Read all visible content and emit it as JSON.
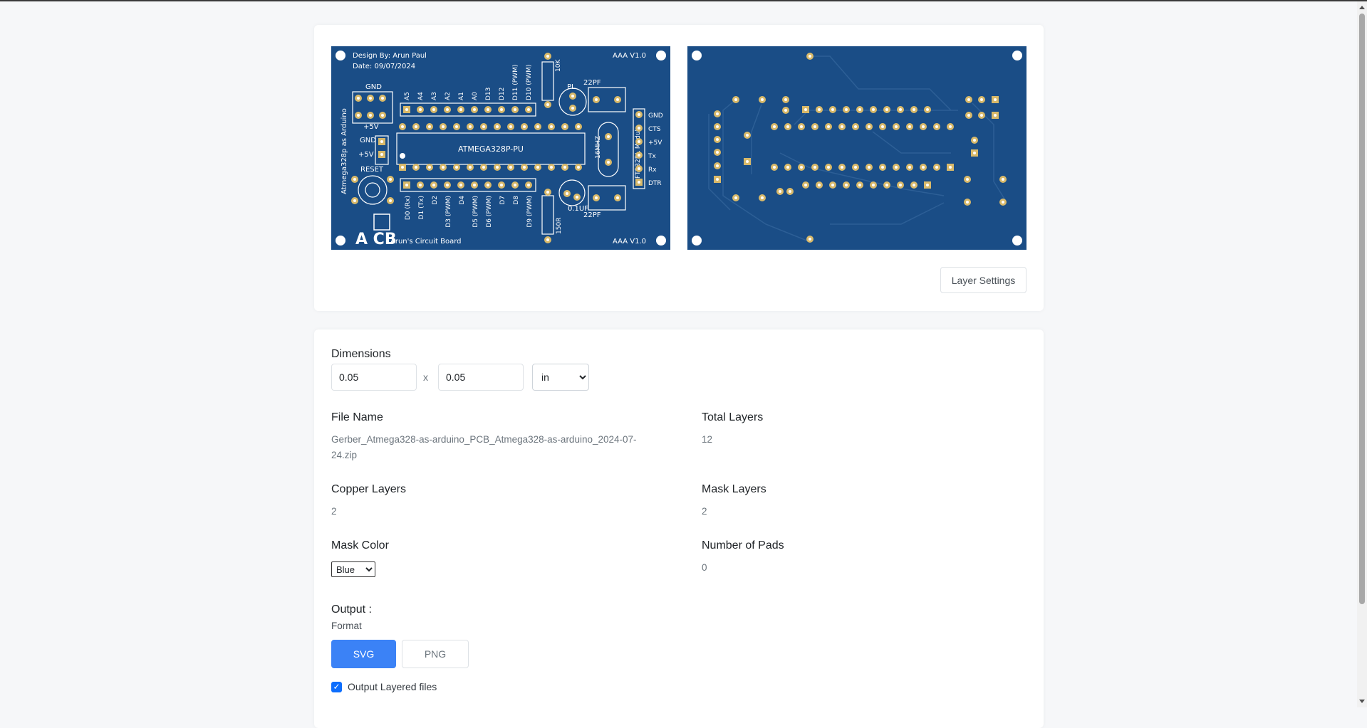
{
  "preview": {
    "front": {
      "design_by": "Design By: Arun Paul",
      "date": "Date: 09/07/2024",
      "version": "AAA V1.0",
      "chip_label": "ATMEGA328P-PU",
      "side_label": "Atmega328p as Arduino",
      "gnd_label": "GND",
      "plus5v_label": "+5V",
      "gnd_label2": "GND",
      "plus5v_label2": "+5V",
      "reset_label": "RESET",
      "top_pins": [
        "A5",
        "A4",
        "A3",
        "A2",
        "A1",
        "A0",
        "D13",
        "D12",
        "D11 (PWM)",
        "D10 (PWM)"
      ],
      "bottom_pins": [
        "D0 (Rx)",
        "D1 (Tx)",
        "D2",
        "D3 (PWM)",
        "D4",
        "D5 (PWM)",
        "D6 (PWM)",
        "D7",
        "D8",
        "D9 (PWM)"
      ],
      "resistor_top": "10K",
      "resistor_bottom": "150R",
      "led_label": "PL",
      "cap_top": "22PF",
      "cap_bottom": "22PF",
      "crystal": "16MHZ",
      "elec_cap": "0.1UF",
      "module_label": "FT232RL Module",
      "module_pins": [
        "GND",
        "CTS",
        "+5V",
        "Tx",
        "Rx",
        "DTR"
      ],
      "brand": "Arun's Circuit Board",
      "logo_text": "A CB"
    },
    "layer_settings_label": "Layer Settings"
  },
  "form": {
    "dimensions_label": "Dimensions",
    "width_value": "0.05",
    "height_value": "0.05",
    "x_sep": "x",
    "unit_selected": "in",
    "file_name_label": "File Name",
    "file_name_value": "Gerber_Atmega328-as-arduino_PCB_Atmega328-as-arduino_2024-07-24.zip",
    "total_layers_label": "Total Layers",
    "total_layers_value": "12",
    "copper_layers_label": "Copper Layers",
    "copper_layers_value": "2",
    "mask_layers_label": "Mask Layers",
    "mask_layers_value": "2",
    "mask_color_label": "Mask Color",
    "mask_color_selected": "Blue",
    "number_of_pads_label": "Number of Pads",
    "number_of_pads_value": "0",
    "output_label": "Output :",
    "format_label": "Format",
    "svg_label": "SVG",
    "png_label": "PNG",
    "output_layered_label": "Output Layered files",
    "output_layered_checked": true
  },
  "colors": {
    "pcb_mask": "#1a4d86",
    "pad": "#d8b96a",
    "silk": "#ffffff",
    "trace_back": "#2d5f96",
    "primary": "#3b82f6"
  }
}
